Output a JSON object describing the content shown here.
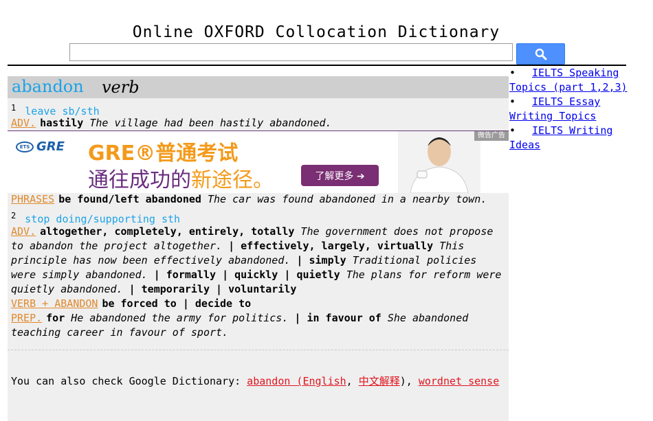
{
  "site": {
    "title": "Online OXFORD Collocation Dictionary",
    "search_value": "",
    "search_placeholder": ""
  },
  "entry": {
    "headword": "abandon",
    "pos": "verb",
    "sense1": {
      "num": "1",
      "definition": "leave sb/sth",
      "adv_tag": "ADV.",
      "adv_word": "hastily",
      "adv_example": "The village had been hastily abandoned.",
      "phrases_tag": "PHRASES",
      "phrases_word": "be found/left abandoned",
      "phrases_example": "The car was found abandoned in a nearby town."
    },
    "sense2": {
      "num": "2",
      "definition": "stop doing/supporting sth",
      "adv_tag": "ADV.",
      "adv_words1": "altogether, completely, entirely, totally",
      "adv_example1": "The government does not propose to abandon the project altogether.",
      "sep": "|",
      "adv_words2": "effectively, largely, virtually",
      "adv_example2": "This principle has now been effectively abandoned.",
      "adv_words3": "simply",
      "adv_example3": "Traditional policies were simply abandoned.",
      "adv_words4": "formally",
      "adv_words5": "quickly",
      "adv_words6": "quietly",
      "adv_example6": "The plans for reform were quietly abandoned.",
      "adv_words7": "temporarily",
      "adv_words8": "voluntarily",
      "verb_tag": "VERB + ABANDON",
      "verb_words1": "be forced to",
      "verb_words2": "decide to",
      "prep_tag": "PREP.",
      "prep_word1": "for",
      "prep_example1": "He abandoned the army for politics.",
      "prep_word2": "in favour of",
      "prep_example2": "She abandoned teaching career in favour of sport."
    }
  },
  "ad": {
    "badge": "微告广告",
    "line1": "GRE®普通考试",
    "line2_a": "通往成功的",
    "line2_b": "新途径。",
    "cta": "了解更多 ➔",
    "logo_ets": "ETS",
    "logo_gre": "GRE",
    "colors": {
      "orange": "#f39a1b",
      "purple": "#6b2d7f"
    }
  },
  "footer": {
    "prefix": "You can also check Google Dictionary:",
    "link1": "abandon (English",
    "comma": ",",
    "link2": "中文解释",
    "close": "),",
    "link3": "wordnet sense"
  },
  "sidebar": {
    "items": [
      {
        "bullet": "•",
        "label": "IELTS Speaking Topics (part 1,2,3)"
      },
      {
        "bullet": "•",
        "label": "IELTS Essay Writing Topics"
      },
      {
        "bullet": "•",
        "label": "IELTS Writing Ideas"
      }
    ]
  },
  "icons": {
    "search": "search-icon"
  },
  "colors": {
    "headword_blue": "#1aa3e8",
    "tag_orange": "#e08a2e",
    "link_red": "#e0141e",
    "search_blue": "#4d90fe"
  }
}
